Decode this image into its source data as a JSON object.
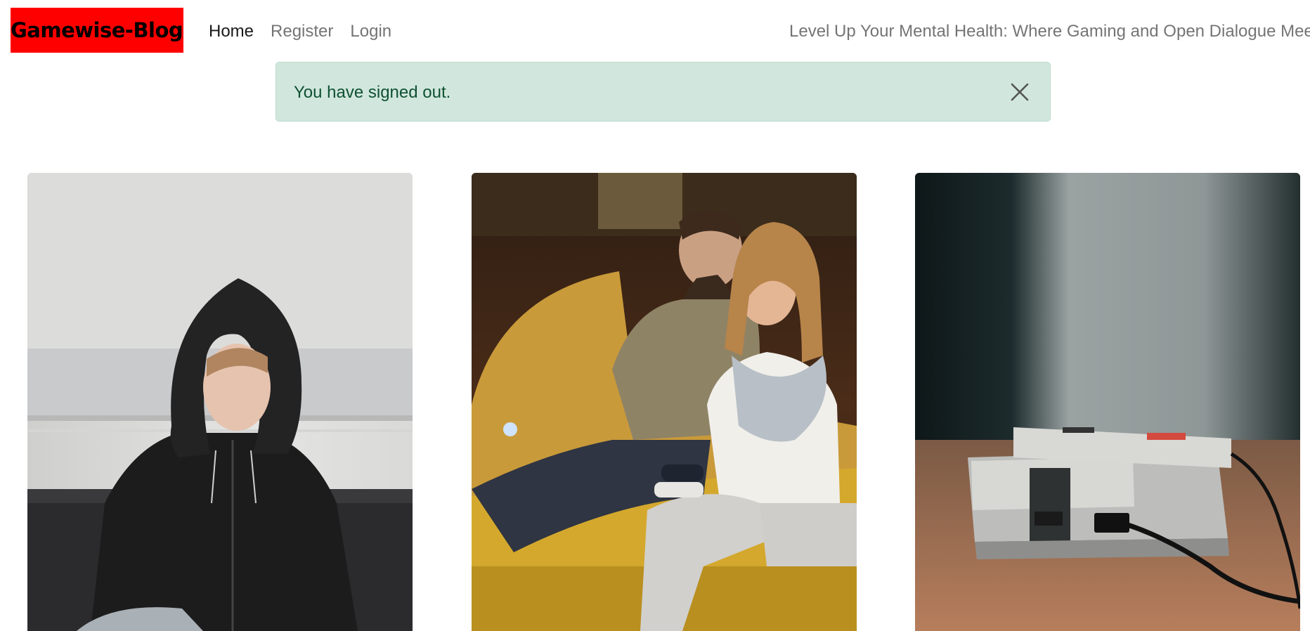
{
  "navbar": {
    "brand": "Gamewise-Blog",
    "links": [
      {
        "label": "Home",
        "active": true
      },
      {
        "label": "Register",
        "active": false
      },
      {
        "label": "Login",
        "active": false
      }
    ],
    "tagline": "Level Up Your Mental Health: Where Gaming and Open Dialogue Meet"
  },
  "alert": {
    "message": "You have signed out.",
    "type": "success"
  },
  "colors": {
    "brand_bg": "#ff0000",
    "alert_bg": "#d1e7dd",
    "alert_text": "#0f5132"
  },
  "posts": [
    {
      "image": "teen-in-black-hoodie-photo"
    },
    {
      "image": "couple-playing-video-games-on-couch-photo"
    },
    {
      "image": "retro-game-console-photo"
    }
  ]
}
